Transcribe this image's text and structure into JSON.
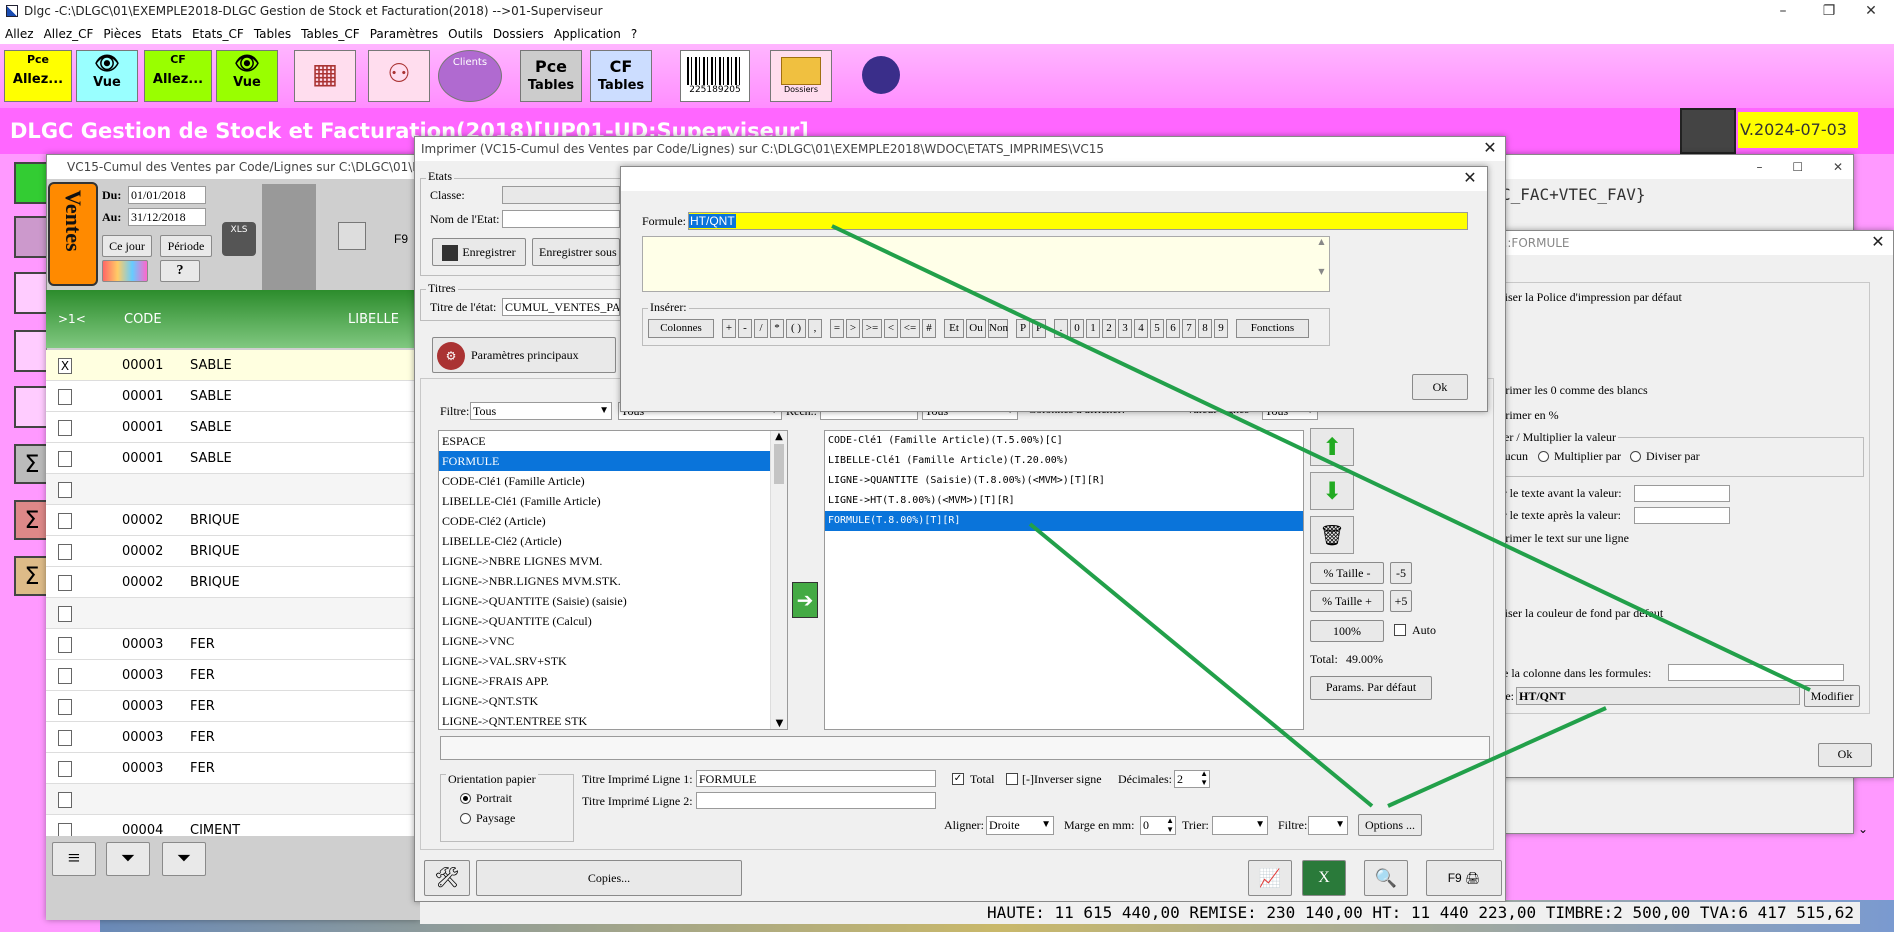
{
  "app": {
    "window_title": "Dlgc -C:\\DLGC\\01\\EXEMPLE2018-DLGC Gestion de Stock et Facturation(2018) -->01-Superviseur",
    "banner": "DLGC Gestion de Stock et Facturation(2018)[UP01-UD:Superviseur]",
    "version": "V.2024-07-03"
  },
  "menu": [
    "Allez",
    "Allez_CF",
    "Pièces",
    "Etats",
    "Etats_CF",
    "Tables",
    "Tables_CF",
    "Paramètres",
    "Outils",
    "Dossiers",
    "Application",
    "?"
  ],
  "toolbar": {
    "pce_allez": {
      "top": "Pce",
      "label": "Allez..."
    },
    "pce_vue": "Vue",
    "cf_allez": {
      "top": "CF",
      "label": "Allez..."
    },
    "cf_vue": "Vue",
    "clients": "Clients",
    "pce_tables": {
      "top": "Pce",
      "label": "Tables"
    },
    "cf_tables": {
      "top": "CF",
      "label": "Tables"
    },
    "barcode": "225189205",
    "dossiers": "Dossiers"
  },
  "vc15": {
    "title": "VC15-Cumul des Ventes par Code/Lignes sur C:\\DLGC\\01\\EXEMPLE2018",
    "ventes": "Ventes",
    "du_label": "Du:",
    "du_value": "01/01/2018",
    "au_label": "Au:",
    "au_value": "31/12/2018",
    "ce_jour": "Ce jour",
    "periode": "Période",
    "question": "?",
    "xls": "XLS",
    "f9": "F9",
    "col_toggle": ">1<",
    "col_code": "CODE",
    "col_libelle": "LIBELLE",
    "rows": [
      {
        "check": "X",
        "code": "00001",
        "lib": "SABLE"
      },
      {
        "check": "",
        "code": "00001",
        "lib": "SABLE"
      },
      {
        "check": "",
        "code": "00001",
        "lib": "SABLE"
      },
      {
        "check": "",
        "code": "00001",
        "lib": "SABLE"
      },
      {
        "check": "",
        "code": "",
        "lib": ""
      },
      {
        "check": "",
        "code": "00002",
        "lib": "BRIQUE"
      },
      {
        "check": "",
        "code": "00002",
        "lib": "BRIQUE"
      },
      {
        "check": "",
        "code": "00002",
        "lib": "BRIQUE"
      },
      {
        "check": "",
        "code": "",
        "lib": ""
      },
      {
        "check": "",
        "code": "00003",
        "lib": "FER"
      },
      {
        "check": "",
        "code": "00003",
        "lib": "FER"
      },
      {
        "check": "",
        "code": "00003",
        "lib": "FER"
      },
      {
        "check": "",
        "code": "00003",
        "lib": "FER"
      },
      {
        "check": "",
        "code": "00003",
        "lib": "FER"
      },
      {
        "check": "",
        "code": "",
        "lib": ""
      },
      {
        "check": "",
        "code": "00004",
        "lib": "CIMENT"
      }
    ]
  },
  "status_bar": "HAUTE: 11 615 440,00   REMISE: 230 140,00   HT: 11 440 223,00   TIMBRE:2 500,00   TVA:6 417 515,62",
  "imprimer": {
    "title": "Imprimer (VC15-Cumul des Ventes par Code/Lignes)  sur C:\\DLGC\\01\\EXEMPLE2018\\WDOC\\ETATS_IMPRIMES\\VC15",
    "etats_group": "Etats",
    "classe_label": "Classe:",
    "nom_etat_label": "Nom de l'Etat:",
    "enregistrer": "Enregistrer",
    "enregistrer_sous": "Enregistrer sous",
    "titres_group": "Titres",
    "titre_etat_label": "Titre de l'état:",
    "titre_etat_value": "CUMUL_VENTES_PA",
    "params_principaux": "Paramètres principaux",
    "filtre_label": "Filtre:",
    "filtre_value": "Tous",
    "filtre2_value": "Tous",
    "rech_label": "Rech.:",
    "tous3": "Tous",
    "colonnes_label": "Colonnes à afficher:",
    "val_lignes_label": "Valeur lignes",
    "tous4": "Tous",
    "left_list": [
      "ESPACE",
      "FORMULE",
      "CODE-Clé1 (Famille Article)",
      "LIBELLE-Clé1 (Famille Article)",
      "CODE-Clé2 (Article)",
      "LIBELLE-Clé2 (Article)",
      "LIGNE->NBRE LIGNES MVM.",
      "LIGNE->NBR.LIGNES MVM.STK.",
      "LIGNE->QUANTITE (Saisie) (saisie)",
      "LIGNE->QUANTITE (Calcul)",
      "LIGNE->VNC",
      "LIGNE->VAL.SRV+STK",
      "LIGNE->FRAIS APP.",
      "LIGNE->QNT.STK",
      "LIGNE->QNT.ENTREE STK"
    ],
    "right_list": [
      "CODE-Clé1 (Famille Article)(T.5.00%)[C]",
      "LIBELLE-Clé1 (Famille Article)(T.20.00%)",
      "LIGNE->QUANTITE (Saisie)(T.8.00%)(<MVM>)[T][R]",
      "LIGNE->HT(T.8.00%)(<MVM>)[T][R]",
      "FORMULE(T.8.00%)[T][R]"
    ],
    "taille_minus": "% Taille -",
    "minus5": "-5",
    "taille_plus": "% Taille +",
    "plus5": "+5",
    "cent": "100%",
    "auto": "Auto",
    "total_label": "Total:",
    "total_value": "49.00%",
    "params_defaut": "Params. Par défaut",
    "orientation_group": "Orientation papier",
    "portrait": "Portrait",
    "paysage": "Paysage",
    "titre1_label": "Titre Imprimé Ligne 1:",
    "titre1_value": "FORMULE",
    "titre2_label": "Titre Imprimé Ligne 2:",
    "titre2_value": "",
    "total_chk": "Total",
    "inverser": "[-]Inverser signe",
    "decimales_label": "Décimales:",
    "decimales_value": "2",
    "aligner_label": "Aligner:",
    "aligner_value": "Droite",
    "marge_label": "Marge en mm:",
    "marge_value": "0",
    "trier_label": "Trier:",
    "filtre_bottom_label": "Filtre:",
    "options": "Options ...",
    "copies": "Copies...",
    "f9_print": "F9"
  },
  "formule_dialog": {
    "label": "Formule:",
    "value": "HT/QNT",
    "inserer": "Insérer:",
    "buttons": [
      "Colonnes",
      "+",
      "-",
      "/",
      "*",
      "( )",
      ",",
      "=",
      ">",
      ">=",
      "<",
      "<=",
      "#",
      "Et",
      "Ou",
      "Non",
      "P",
      "P",
      ".",
      "0",
      "1",
      "2",
      "3",
      "4",
      "5",
      "6",
      "7",
      "8",
      "9",
      "Fonctions"
    ],
    "ok": "Ok"
  },
  "appl_formule": {
    "title": "ppl.:FORMULE",
    "expression_text": "C_FAC+VTEC_FAV}",
    "police": "Utiliser la Police d'impression par défaut",
    "zeros": "Imprimer les 0 comme des blancs",
    "en_pct": "Imprimer en %",
    "diviser_group": "Diviser / Multiplier la valeur",
    "aucun": "Aucun",
    "multiplier": "Multiplier par",
    "diviser": "Diviser par",
    "texte_avant": "Ajouter le texte avant la valeur:",
    "texte_apres": "Ajouter le texte après la valeur:",
    "une_ligne": "Imprimer le text sur une ligne",
    "couleur_fond": "Utiliser la couleur de fond  par défaut",
    "nom_colonne": "Nom de la colonne dans les formules:",
    "formule_label": "Formule:",
    "formule_value": "HT/QNT",
    "modifier": "Modifier",
    "ok": "Ok"
  },
  "colors": {
    "accent": "#0a74da",
    "yellow": "#ffff00",
    "green_arrow": "#22a04a",
    "pink": "#ff99ff"
  }
}
